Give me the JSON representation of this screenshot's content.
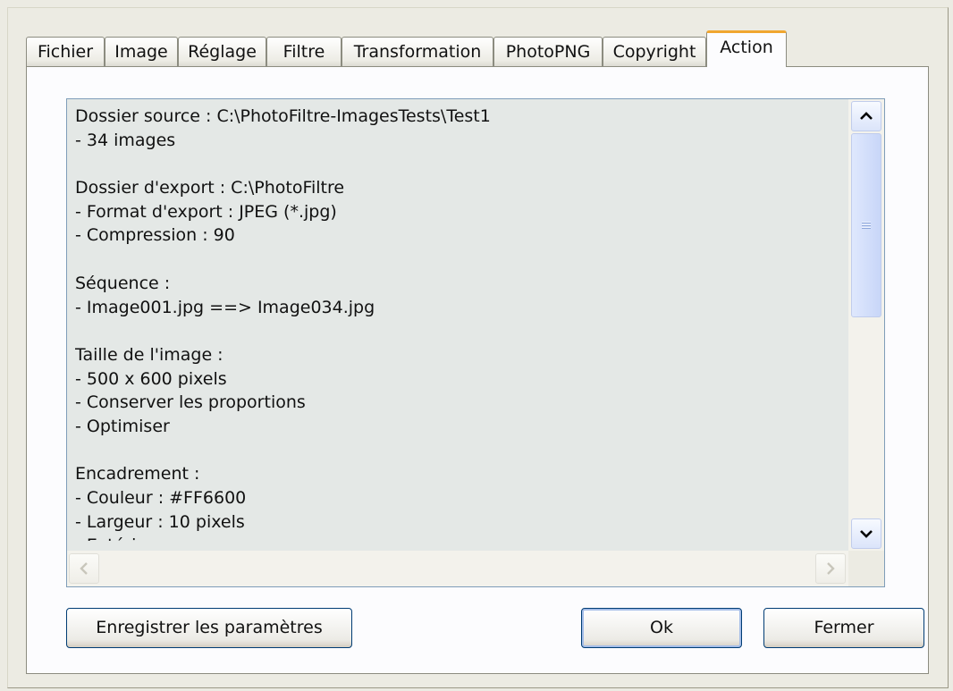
{
  "tabs": [
    {
      "label": "Fichier",
      "active": false
    },
    {
      "label": "Image",
      "active": false
    },
    {
      "label": "Réglage",
      "active": false
    },
    {
      "label": "Filtre",
      "active": false
    },
    {
      "label": "Transformation",
      "active": false
    },
    {
      "label": "PhotoPNG",
      "active": false
    },
    {
      "label": "Copyright",
      "active": false
    },
    {
      "label": "Action",
      "active": true
    }
  ],
  "report": {
    "lines": [
      "Dossier source : C:\\PhotoFiltre-ImagesTests\\Test1",
      "- 34 images",
      "",
      "Dossier d'export : C:\\PhotoFiltre",
      "- Format d'export : JPEG (*.jpg)",
      "- Compression : 90",
      "",
      "Séquence :",
      "- Image001.jpg ==> Image034.jpg",
      "",
      "Taille de l'image :",
      "- 500 x 600 pixels",
      "- Conserver les proportions",
      "- Optimiser",
      "",
      "Encadrement :",
      "- Couleur : #FF6600",
      "- Largeur : 10 pixels",
      "- Extérieur"
    ]
  },
  "buttons": {
    "save_params": "Enregistrer les paramètres",
    "ok": "Ok",
    "close": "Fermer"
  },
  "icons": {
    "scroll_up": "chevron-up-icon",
    "scroll_down": "chevron-down-icon",
    "scroll_left": "chevron-left-icon",
    "scroll_right": "chevron-right-icon"
  },
  "colors": {
    "active_tab_accent": "#f0a630",
    "report_background": "#e4e8e6",
    "button_border": "#003c74"
  }
}
